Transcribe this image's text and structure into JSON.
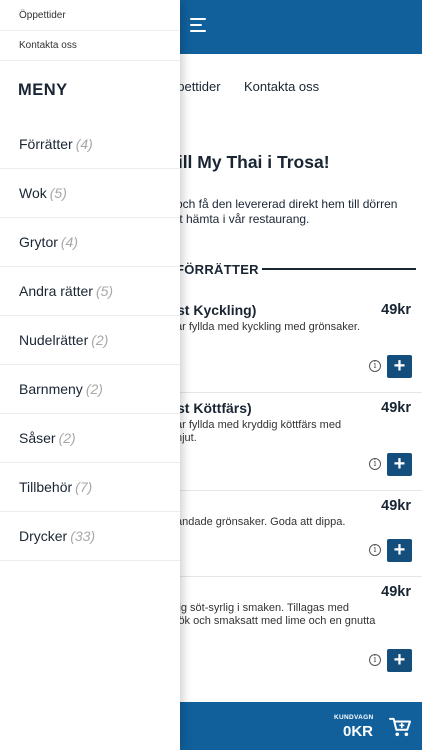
{
  "colors": {
    "brand": "#11609c",
    "button": "#134e7c",
    "text": "#1a2533"
  },
  "drawer": {
    "top_links": [
      "Öppettider",
      "Kontakta oss"
    ],
    "menu_heading": "MENY",
    "categories": [
      {
        "label": "Förrätter",
        "count": "(4)"
      },
      {
        "label": "Wok",
        "count": "(5)"
      },
      {
        "label": "Grytor",
        "count": "(4)"
      },
      {
        "label": "Andra rätter",
        "count": "(5)"
      },
      {
        "label": "Nudelrätter",
        "count": "(2)"
      },
      {
        "label": "Barnmeny",
        "count": "(2)"
      },
      {
        "label": "Såser",
        "count": "(2)"
      },
      {
        "label": "Tillbehör",
        "count": "(7)"
      },
      {
        "label": "Drycker",
        "count": "(33)"
      }
    ]
  },
  "header": {
    "menu_icon": "hamburger-icon"
  },
  "subnav": {
    "items": [
      "ppettider",
      "Kontakta oss"
    ]
  },
  "main": {
    "welcome": "till My Thai i Trosa!",
    "intro_lines": [
      "och få den levererad direkt hem till dörren",
      "tt hämta i vår restaurang."
    ],
    "section_title": "FÖRRÄTTER",
    "dishes": [
      {
        "name": "st Kyckling)",
        "desc_lines": [
          "ar fyllda med kyckling med grönsaker."
        ],
        "price": "49kr"
      },
      {
        "name": "st Köttfärs)",
        "desc_lines": [
          "ar fyllda med kryddig köttfärs med",
          "njut."
        ],
        "price": "49kr"
      },
      {
        "name": "",
        "desc_lines": [
          "andade grönsaker. Goda att dippa."
        ],
        "price": "49kr"
      },
      {
        "name": "",
        "desc_lines": [
          "lig söt-syrlig i smaken. Tillagas med",
          "lök och smaksatt med lime och en gnutta"
        ],
        "price": "49kr"
      }
    ],
    "info_glyph": "i",
    "add_glyph": "+"
  },
  "cart": {
    "label": "KUNDVAGN",
    "total": "0KR",
    "icon": "cart-icon"
  }
}
